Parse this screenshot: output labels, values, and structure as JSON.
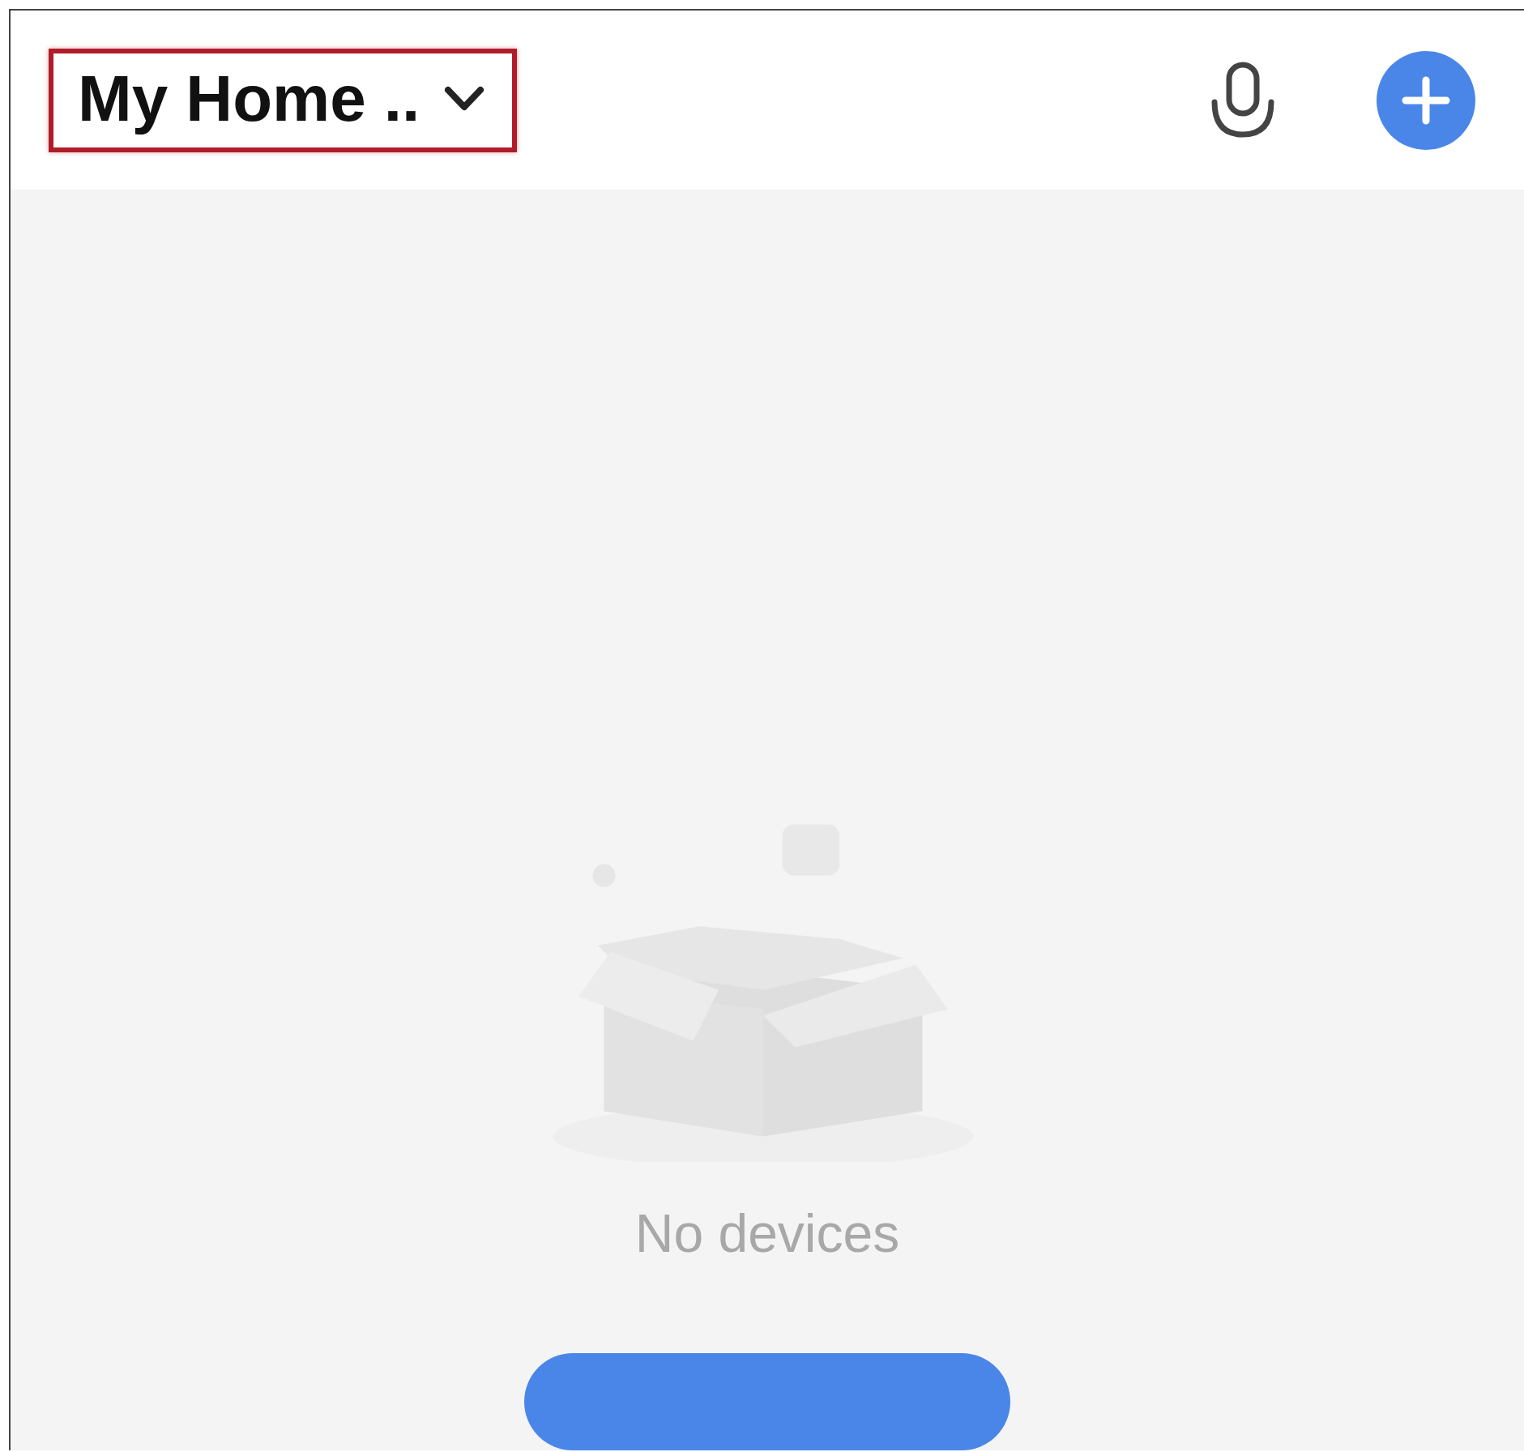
{
  "header": {
    "home_selector": {
      "label": "My Home ..",
      "highlighted": true
    }
  },
  "empty_state": {
    "message": "No devices"
  }
}
